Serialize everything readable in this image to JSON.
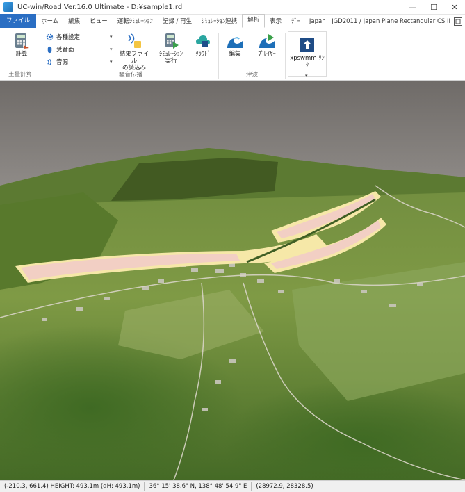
{
  "window": {
    "title": "UC-win/Road Ver.16.0 Ultimate - D:¥sample1.rd",
    "minimize": "—",
    "maximize": "☐",
    "close": "✕"
  },
  "menu": {
    "tabs": [
      "ファイル",
      "ホーム",
      "編集",
      "ビュー",
      "運転ｼﾐｭﾚｰｼｮﾝ",
      "記録 / 再生",
      "ｼﾐｭﾚｰｼｮﾝ連携",
      "解析",
      "表示",
      "ﾃﾞｰ"
    ],
    "active_tab": "解析",
    "coordinate_system": "Japan　JGD2011 / Japan Plane Rectangular CS II"
  },
  "ribbon": {
    "earthwork": {
      "label": "土量計算",
      "calc_button": "計算"
    },
    "noise": {
      "label": "騒音伝播",
      "settings": "各種設定",
      "sound_barrier": "受音面",
      "sound_source": "音源",
      "load_result": "結果ファイル\nの読込み",
      "run_sim": "ｼﾐｭﾚｰｼｮﾝ\n実行",
      "cloud": "ｸﾗｳﾄﾞ"
    },
    "tsunami": {
      "label": "津波",
      "edit": "編集",
      "player": "ﾌﾟﾚｲﾔｰ"
    },
    "xpswmm": {
      "link": "xpswmm ﾘﾝｸ"
    }
  },
  "status": {
    "position": "(-210.3, 661.4) HEIGHT: 493.1m (dH: 493.1m)",
    "latlon": "36° 15' 38.6\" N, 138° 48' 54.9\" E",
    "plane_xy": "(28972.9, 28328.5)"
  }
}
